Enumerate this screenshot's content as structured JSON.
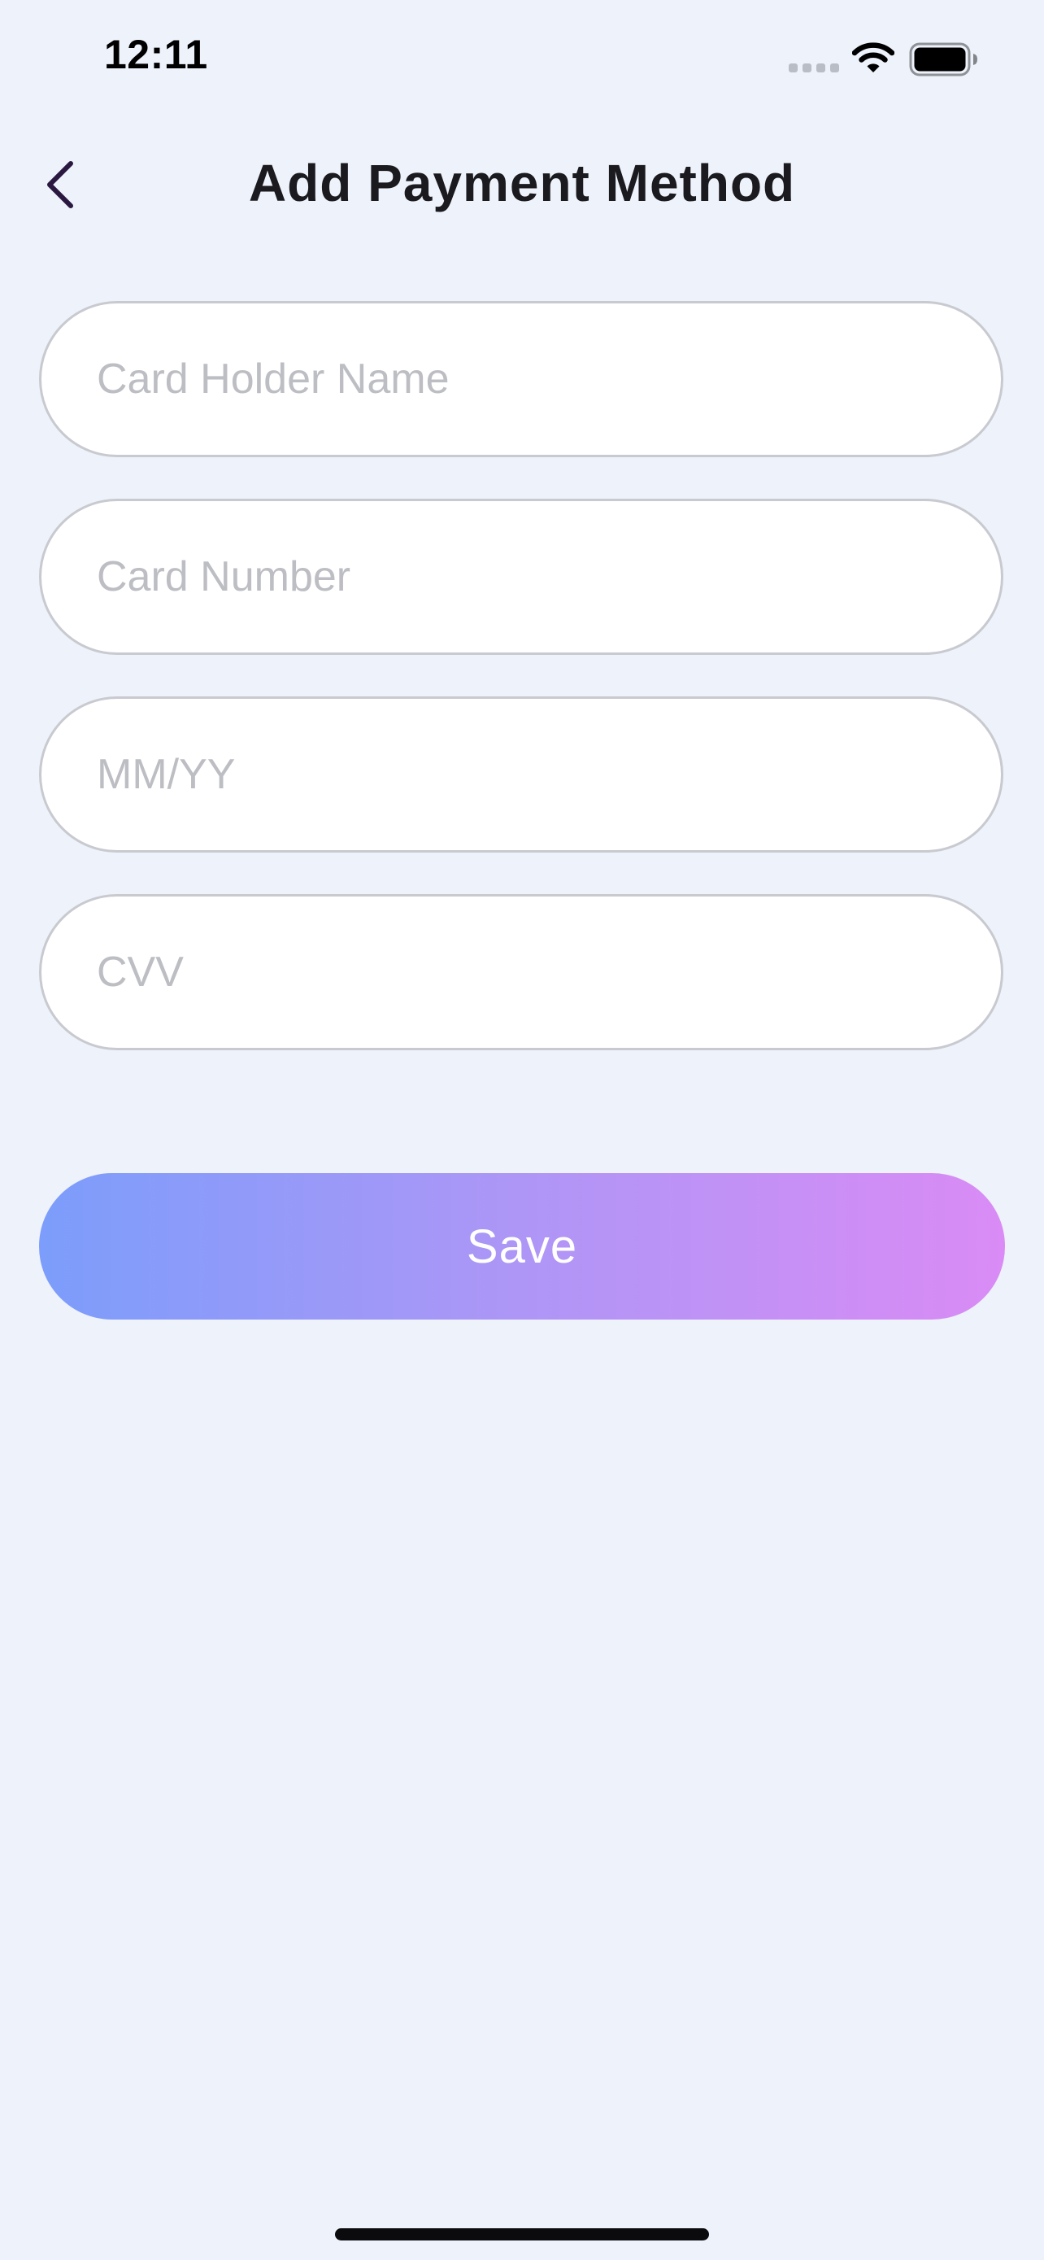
{
  "status_bar": {
    "time": "12:11",
    "icons": [
      "cellular-signal-icon",
      "wifi-icon",
      "battery-icon"
    ]
  },
  "header": {
    "title": "Add Payment Method",
    "back_icon": "chevron-left-icon"
  },
  "form": {
    "card_holder_name": {
      "value": "",
      "placeholder": "Card Holder Name"
    },
    "card_number": {
      "value": "",
      "placeholder": "Card Number"
    },
    "expiry": {
      "value": "",
      "placeholder": "MM/YY"
    },
    "cvv": {
      "value": "",
      "placeholder": "CVV"
    }
  },
  "actions": {
    "save_label": "Save"
  },
  "colors": {
    "background": "#EDF2FB",
    "gradient_start": "#7C9DFB",
    "gradient_end": "#DA8BF5",
    "back_chevron": "#2A1840",
    "title_text": "#1A1A1F",
    "placeholder_text": "#BDBEC3",
    "field_border": "#C9CAD0"
  }
}
